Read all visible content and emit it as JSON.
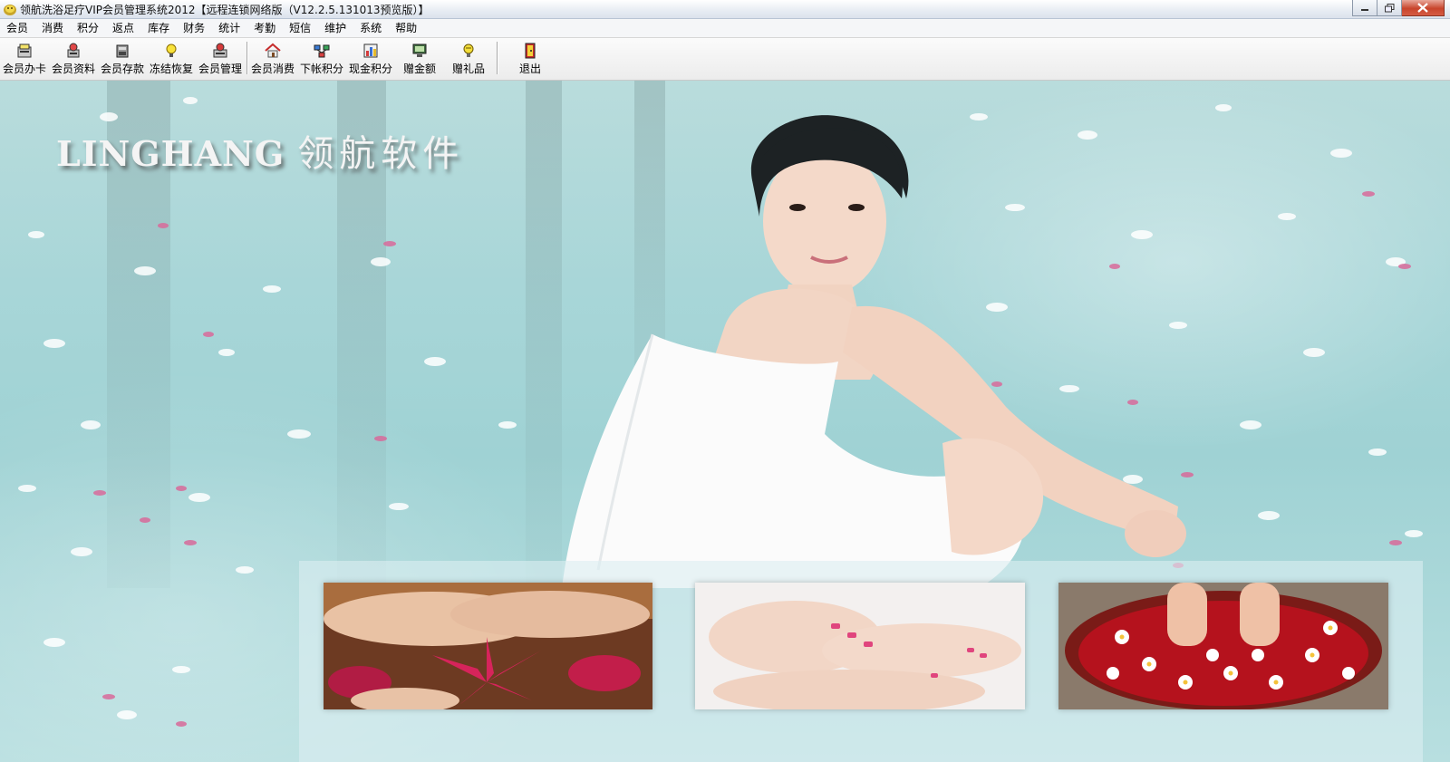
{
  "window": {
    "title": "领航洗浴足疗VIP会员管理系统2012【远程连锁网络版（V12.2.5.131013预览版）】"
  },
  "menu": [
    "会员",
    "消费",
    "积分",
    "返点",
    "库存",
    "财务",
    "统计",
    "考勤",
    "短信",
    "维护",
    "系统",
    "帮助"
  ],
  "toolbar": {
    "buttons": [
      {
        "label": "会员办卡",
        "icon": "card-icon"
      },
      {
        "label": "会员资料",
        "icon": "member-info-icon"
      },
      {
        "label": "会员存款",
        "icon": "deposit-icon"
      },
      {
        "label": "冻结恢复",
        "icon": "lightbulb-icon"
      },
      {
        "label": "会员管理",
        "icon": "member-manage-icon"
      },
      {
        "label": "会员消费",
        "icon": "home-icon"
      },
      {
        "label": "下帐积分",
        "icon": "network-icon"
      },
      {
        "label": "现金积分",
        "icon": "chart-icon"
      },
      {
        "label": "赠金额",
        "icon": "monitor-icon"
      },
      {
        "label": "赠礼品",
        "icon": "gift-icon"
      },
      {
        "label": "退出",
        "icon": "exit-door-icon"
      }
    ]
  },
  "banner": {
    "brand_en": "LINGHANG",
    "brand_cn": "领航软件"
  },
  "colors": {
    "water": "#a8d6d8",
    "petal_pink": "#d86a9a",
    "towel_white": "#ffffff"
  }
}
